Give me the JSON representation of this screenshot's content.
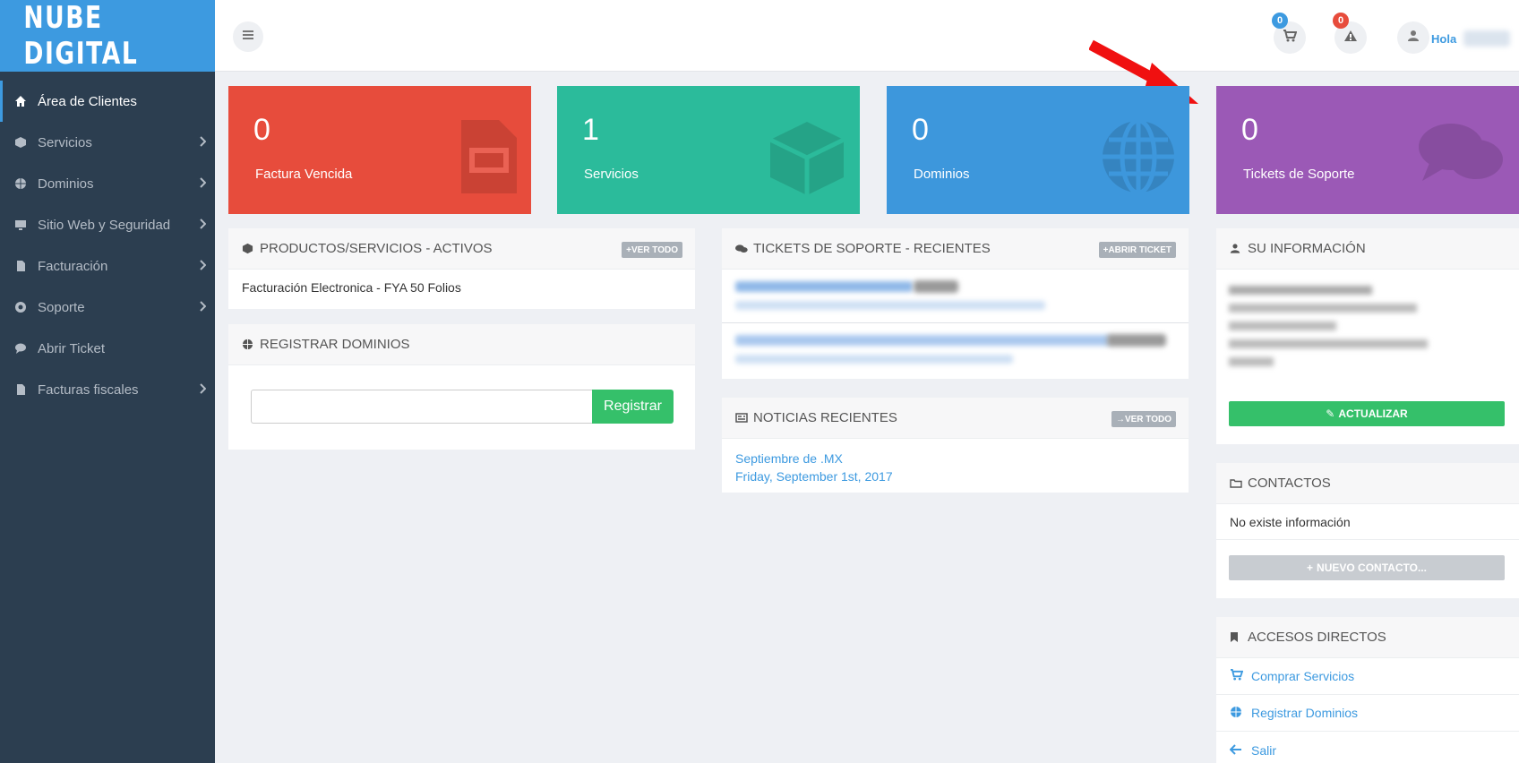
{
  "brand": {
    "logo_text": "NUBE DIGITAL",
    "accent": "#3d9ae0"
  },
  "sidebar": {
    "items": [
      {
        "label": "Área de Clientes",
        "icon": "home-icon",
        "active": true,
        "submenu": false
      },
      {
        "label": "Servicios",
        "icon": "cube-icon",
        "active": false,
        "submenu": true
      },
      {
        "label": "Dominios",
        "icon": "globe-icon",
        "active": false,
        "submenu": true
      },
      {
        "label": "Sitio Web y Seguridad",
        "icon": "desktop-icon",
        "active": false,
        "submenu": true
      },
      {
        "label": "Facturación",
        "icon": "file-icon",
        "active": false,
        "submenu": true
      },
      {
        "label": "Soporte",
        "icon": "lifebuoy-icon",
        "active": false,
        "submenu": true
      },
      {
        "label": "Abrir Ticket",
        "icon": "comment-icon",
        "active": false,
        "submenu": false
      },
      {
        "label": "Facturas fiscales",
        "icon": "file-icon",
        "active": false,
        "submenu": true
      }
    ]
  },
  "topbar": {
    "cart_count": "0",
    "alerts_count": "0",
    "greeting": "Hola"
  },
  "stats": [
    {
      "value": "0",
      "label": "Factura Vencida",
      "color": "#e74c3c",
      "icon": "invoice-icon"
    },
    {
      "value": "1",
      "label": "Servicios",
      "color": "#2bbb9b",
      "icon": "cube-icon"
    },
    {
      "value": "0",
      "label": "Dominios",
      "color": "#3d97dc",
      "icon": "globe-icon"
    },
    {
      "value": "0",
      "label": "Tickets de Soporte",
      "color": "#9b59b6",
      "icon": "comments-icon"
    }
  ],
  "products": {
    "title": "PRODUCTOS/SERVICIOS - ACTIVOS",
    "button": "VER TODO",
    "items": [
      "Facturación Electronica - FYA 50 Folios"
    ]
  },
  "register_domains": {
    "title": "REGISTRAR DOMINIOS",
    "input_value": "",
    "button": "Registrar"
  },
  "tickets": {
    "title": "TICKETS DE SOPORTE - RECIENTES",
    "button": "ABRIR TICKET"
  },
  "news": {
    "title": "NOTICIAS RECIENTES",
    "button": "VER TODO",
    "item_title": "Septiembre de .MX",
    "item_date": "Friday, September 1st, 2017"
  },
  "info": {
    "title": "SU INFORMACIÓN",
    "button": "ACTUALIZAR"
  },
  "contacts": {
    "title": "CONTACTOS",
    "empty": "No existe información",
    "button": "NUEVO CONTACTO..."
  },
  "shortcuts": {
    "title": "ACCESOS DIRECTOS",
    "items": [
      {
        "label": "Comprar Servicios",
        "icon": "cart-icon"
      },
      {
        "label": "Registrar Dominios",
        "icon": "globe-icon"
      },
      {
        "label": "Salir",
        "icon": "arrow-left-icon"
      }
    ]
  }
}
